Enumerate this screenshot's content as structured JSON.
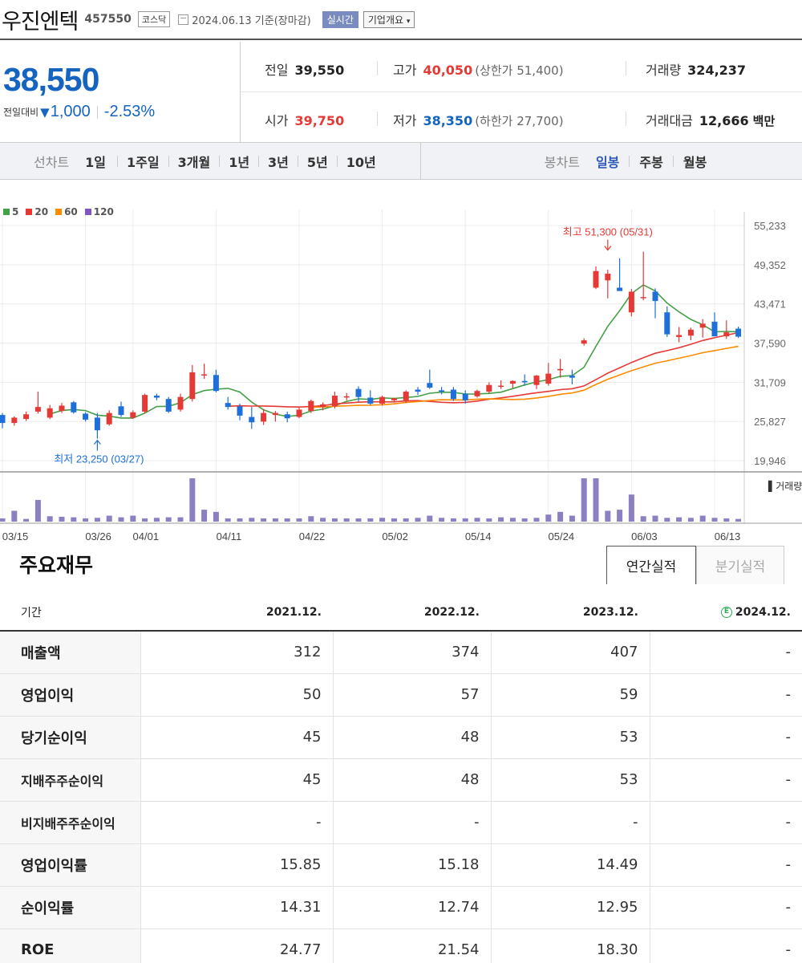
{
  "header": {
    "company_name": "우진엔텍",
    "stock_code": "457550",
    "market": "코스닥",
    "date": "2024.06.13",
    "basis": "기준(장마감)",
    "realtime_label": "실시간",
    "company_info_label": "기업개요",
    "company_info_icon": "chevron-down-icon"
  },
  "price": {
    "current": "38,550",
    "change_label": "전일대비",
    "change_direction_icon": "down-triangle-icon",
    "change_amount": "1,000",
    "change_rate": "-2.53%",
    "prev_close_label": "전일",
    "prev_close": "39,550",
    "open_label": "시가",
    "open": "39,750",
    "high_label": "고가",
    "high": "40,050",
    "upper_limit": "(상한가 51,400)",
    "low_label": "저가",
    "low": "38,350",
    "lower_limit": "(하한가 27,700)",
    "volume_label": "거래량",
    "volume": "324,237",
    "amount_label": "거래대금",
    "amount": "12,666",
    "amount_unit": "백만"
  },
  "periods": {
    "line_label": "선차트",
    "line_items": [
      "1일",
      "1주일",
      "3개월",
      "1년",
      "3년",
      "5년",
      "10년"
    ],
    "candle_label": "봉차트",
    "candle_items": [
      "일봉",
      "주봉",
      "월봉"
    ],
    "active_candle": "일봉"
  },
  "chart_data": {
    "type": "candlestick",
    "legend": [
      {
        "name": "5",
        "color": "#43a047"
      },
      {
        "name": "20",
        "color": "#e53935"
      },
      {
        "name": "60",
        "color": "#fb8c00"
      },
      {
        "name": "120",
        "color": "#7e57c2"
      }
    ],
    "y_ticks": [
      "55,233",
      "49,352",
      "43,471",
      "37,590",
      "31,709",
      "25,827",
      "19,946"
    ],
    "ylim": [
      19946,
      55233
    ],
    "x_ticks": [
      "03/15",
      "03/26",
      "04/01",
      "04/11",
      "04/22",
      "05/02",
      "05/14",
      "05/24",
      "06/03",
      "06/13"
    ],
    "x_tick_index": [
      0,
      7,
      11,
      18,
      25,
      32,
      39,
      46,
      53,
      60
    ],
    "high_annotation": "최고 51,300 (05/31)",
    "high_value": 51300,
    "high_index": 51,
    "low_annotation": "최저 23,250 (03/27)",
    "low_value": 23250,
    "low_index": 8,
    "volume_label": "거래량",
    "up_color": "#e53935",
    "down_color": "#1e6fd9",
    "ohlc": [
      [
        26800,
        27100,
        24800,
        25600
      ],
      [
        25600,
        26600,
        25200,
        26400
      ],
      [
        26200,
        27300,
        25900,
        26900
      ],
      [
        27300,
        30300,
        27000,
        28000
      ],
      [
        26400,
        28300,
        26200,
        27800
      ],
      [
        27400,
        28600,
        27100,
        28200
      ],
      [
        28700,
        28900,
        27000,
        27200
      ],
      [
        27000,
        27200,
        25800,
        26100
      ],
      [
        26400,
        27100,
        23250,
        24500
      ],
      [
        25400,
        27500,
        25200,
        27100
      ],
      [
        28100,
        28800,
        26500,
        26800
      ],
      [
        26400,
        27500,
        26200,
        27200
      ],
      [
        27300,
        30000,
        27000,
        29800
      ],
      [
        29700,
        30000,
        29000,
        29400
      ],
      [
        29200,
        29500,
        27100,
        27300
      ],
      [
        27600,
        30000,
        27300,
        29500
      ],
      [
        29200,
        34300,
        28800,
        33200
      ],
      [
        32800,
        34500,
        32200,
        32900
      ],
      [
        32800,
        33600,
        30200,
        30400
      ],
      [
        28600,
        29500,
        27600,
        28000
      ],
      [
        28100,
        28500,
        26000,
        26700
      ],
      [
        26500,
        28000,
        24700,
        25700
      ],
      [
        25800,
        27700,
        25300,
        27100
      ],
      [
        26800,
        27400,
        25800,
        27100
      ],
      [
        26900,
        27300,
        25700,
        26300
      ],
      [
        26500,
        28000,
        26300,
        27600
      ],
      [
        27400,
        29100,
        27100,
        28900
      ],
      [
        28000,
        28700,
        27500,
        28400
      ],
      [
        28100,
        30300,
        27800,
        29700
      ],
      [
        29600,
        30100,
        29000,
        29600
      ],
      [
        30700,
        31100,
        28800,
        29500
      ],
      [
        29400,
        30500,
        28300,
        28500
      ],
      [
        28500,
        29700,
        28200,
        29500
      ],
      [
        29000,
        29400,
        28800,
        29300
      ],
      [
        29000,
        30500,
        28600,
        30300
      ],
      [
        30600,
        31000,
        29800,
        30300
      ],
      [
        31600,
        33600,
        30700,
        30900
      ],
      [
        30500,
        31000,
        29900,
        30300
      ],
      [
        30600,
        31000,
        28900,
        29200
      ],
      [
        30000,
        30500,
        28500,
        29000
      ],
      [
        29600,
        30600,
        29400,
        30400
      ],
      [
        30300,
        31700,
        30000,
        31300
      ],
      [
        31200,
        32000,
        30700,
        31200
      ],
      [
        31500,
        32000,
        30800,
        31900
      ],
      [
        31900,
        32900,
        31200,
        31700
      ],
      [
        31300,
        32800,
        30700,
        32700
      ],
      [
        31500,
        34600,
        31200,
        33000
      ],
      [
        33500,
        35200,
        32400,
        33700
      ],
      [
        32700,
        33600,
        31400,
        32400
      ],
      [
        37500,
        38300,
        37200,
        38000
      ],
      [
        45900,
        49100,
        45700,
        48400
      ],
      [
        47000,
        48600,
        44300,
        48000
      ],
      [
        45900,
        50300,
        45700,
        45400
      ],
      [
        42200,
        45700,
        41600,
        45300
      ],
      [
        44400,
        51300,
        44000,
        44500
      ],
      [
        45300,
        45800,
        41300,
        43900
      ],
      [
        42200,
        43100,
        38500,
        38900
      ],
      [
        38500,
        40000,
        37700,
        38800
      ],
      [
        38700,
        39900,
        38000,
        39600
      ],
      [
        39900,
        41200,
        38400,
        40500
      ],
      [
        40800,
        42200,
        38600,
        38600
      ],
      [
        38600,
        41000,
        38200,
        39200
      ],
      [
        39750,
        40050,
        38350,
        38550
      ]
    ],
    "volume": [
      6,
      20,
      5,
      40,
      10,
      9,
      8,
      6,
      7,
      11,
      8,
      11,
      6,
      7,
      8,
      8,
      80,
      22,
      18,
      6,
      6,
      7,
      6,
      6,
      6,
      6,
      10,
      7,
      6,
      6,
      6,
      6,
      7,
      6,
      6,
      7,
      11,
      7,
      6,
      6,
      7,
      6,
      8,
      7,
      6,
      7,
      13,
      18,
      11,
      80,
      80,
      20,
      22,
      50,
      10,
      11,
      7,
      8,
      7,
      11,
      7,
      6,
      5
    ]
  },
  "financials": {
    "title": "주요재무",
    "tab_annual": "연간실적",
    "tab_quarterly": "분기실적",
    "period_header": "기간",
    "estimate_icon": "estimate-badge-icon",
    "estimate_mark": "E",
    "columns": [
      "2021.12.",
      "2022.12.",
      "2023.12.",
      "2024.12."
    ],
    "rows": [
      {
        "label": "매출액",
        "values": [
          "312",
          "374",
          "407",
          "-"
        ]
      },
      {
        "label": "영업이익",
        "values": [
          "50",
          "57",
          "59",
          "-"
        ]
      },
      {
        "label": "당기순이익",
        "values": [
          "45",
          "48",
          "53",
          "-"
        ]
      },
      {
        "label": "지배주주순이익",
        "values": [
          "45",
          "48",
          "53",
          "-"
        ]
      },
      {
        "label": "비지배주주순이익",
        "values": [
          "-",
          "-",
          "-",
          "-"
        ]
      },
      {
        "label": "영업이익률",
        "values": [
          "15.85",
          "15.18",
          "14.49",
          "-"
        ]
      },
      {
        "label": "순이익률",
        "values": [
          "14.31",
          "12.74",
          "12.95",
          "-"
        ]
      },
      {
        "label": "ROE",
        "values": [
          "24.77",
          "21.54",
          "18.30",
          "-"
        ]
      }
    ]
  }
}
